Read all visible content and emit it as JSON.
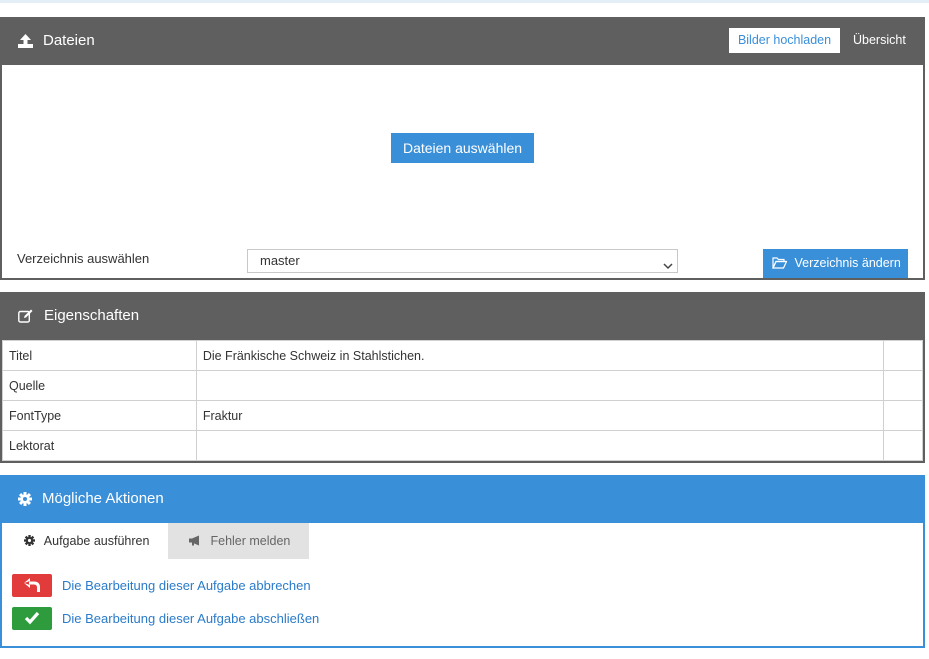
{
  "files_panel": {
    "title": "Dateien",
    "upload_images_label": "Bilder hochladen",
    "overview_label": "Übersicht",
    "select_files_label": "Dateien auswählen",
    "directory_label": "Verzeichnis auswählen",
    "directory_selected": "master",
    "change_directory_label": "Verzeichnis ändern"
  },
  "properties_panel": {
    "title": "Eigenschaften",
    "rows": [
      {
        "key": "Titel",
        "value": "Die Fränkische Schweiz in Stahlstichen."
      },
      {
        "key": "Quelle",
        "value": ""
      },
      {
        "key": "FontType",
        "value": "Fraktur"
      },
      {
        "key": "Lektorat",
        "value": ""
      }
    ]
  },
  "actions_panel": {
    "title": "Mögliche Aktionen",
    "tabs": [
      {
        "label": "Aufgabe ausführen",
        "icon": "gear-icon",
        "active": true
      },
      {
        "label": "Fehler melden",
        "icon": "bullhorn-icon",
        "active": false
      }
    ],
    "actions": [
      {
        "label": "Die Bearbeitung dieser Aufgabe abbrechen",
        "icon": "undo-arrow-icon",
        "color": "#e13b3b"
      },
      {
        "label": "Die Bearbeitung dieser Aufgabe abschließen",
        "icon": "check-icon",
        "color": "#2e9c3c"
      }
    ]
  },
  "colors": {
    "panel_header": "#5f5f5f",
    "accent": "#3a8fd9",
    "danger": "#e13b3b",
    "success": "#2e9c3c"
  }
}
